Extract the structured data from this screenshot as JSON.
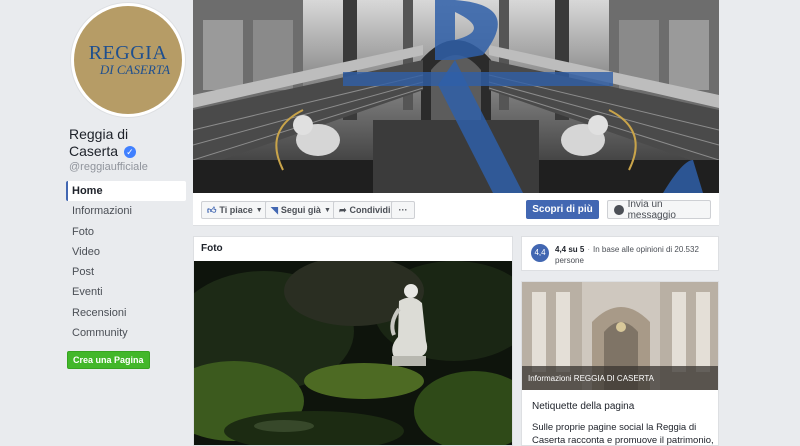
{
  "logo": {
    "line1": "REGGIA",
    "line2": "DI CASERTA"
  },
  "page": {
    "name": "Reggia di Caserta",
    "verified_mark": "✓",
    "handle": "@reggiaufficiale"
  },
  "nav": [
    "Home",
    "Informazioni",
    "Foto",
    "Video",
    "Post",
    "Eventi",
    "Recensioni",
    "Community"
  ],
  "create_page_label": "Crea una Pagina",
  "actions": {
    "like": "Ti piace",
    "follow": "Segui già",
    "share": "Condividi",
    "more": "···",
    "discover": "Scopri di più",
    "message": "Invia un messaggio"
  },
  "photos": {
    "title": "Foto"
  },
  "rating": {
    "value": "4,4",
    "summary": "4,4 su 5",
    "based_on": "In base alle opinioni di 20.532 persone"
  },
  "info": {
    "caption": "Informazioni REGGIA DI CASERTA",
    "title": "Netiquette della pagina",
    "body": "Sulle proprie pagine social la Reggia di Caserta racconta e promuove il patrimonio,"
  },
  "colors": {
    "brand_blue": "#4267b2",
    "logo_gold": "#b69c66",
    "logo_text": "#1e4f8f",
    "create_green": "#42b72a"
  }
}
